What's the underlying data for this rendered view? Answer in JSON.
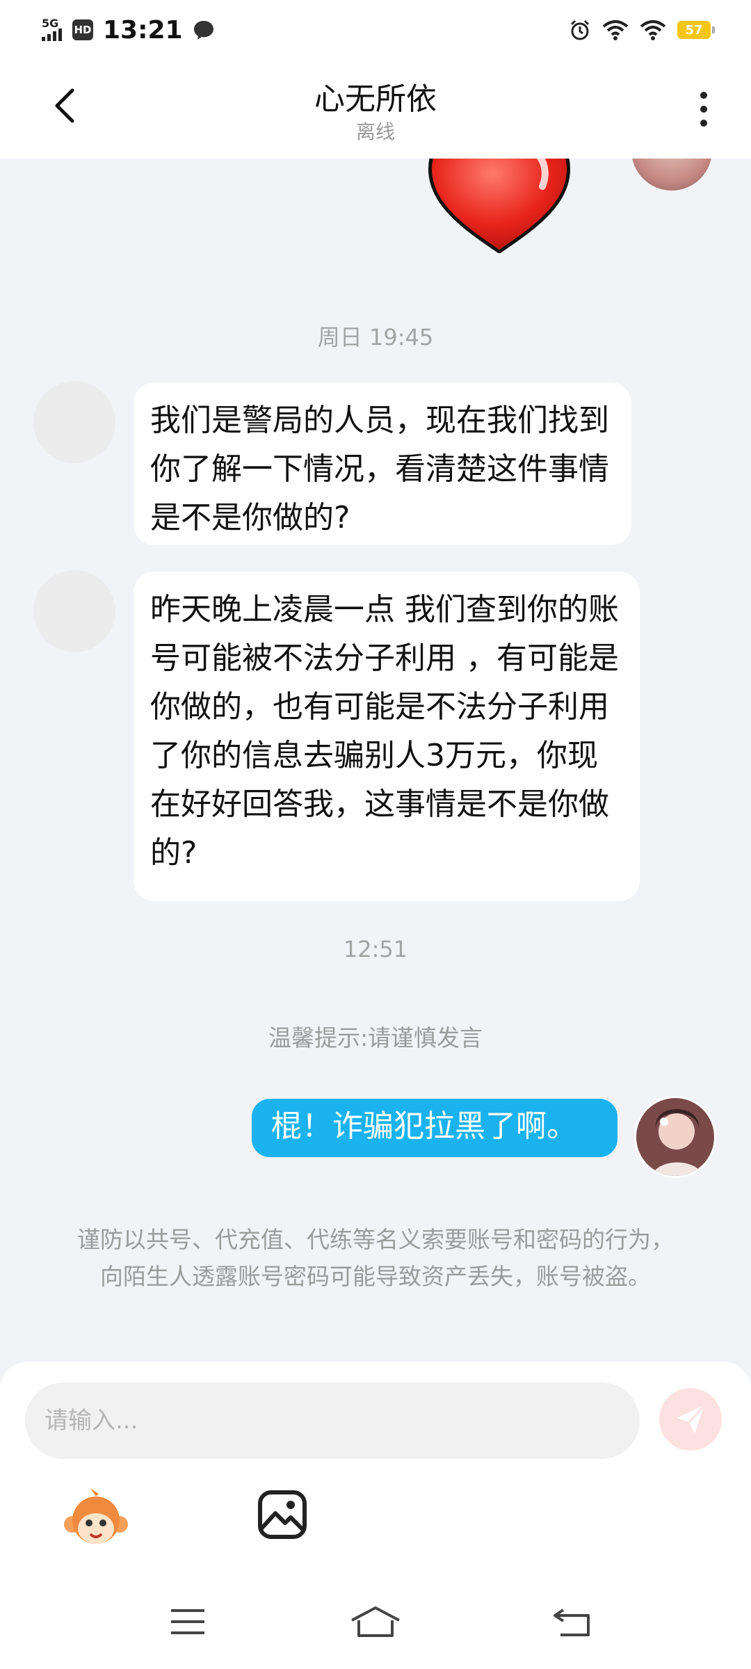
{
  "status_bar": {
    "network": "5G",
    "hd": "HD",
    "time": "13:21",
    "battery": "57"
  },
  "header": {
    "title": "心无所依",
    "subtitle": "离线"
  },
  "messages": [
    {
      "type": "timestamp",
      "text": "周日 19:45"
    },
    {
      "type": "incoming",
      "text": "我们是警局的人员，现在我们找到你了解一下情况，看清楚这件事情是不是你做的?"
    },
    {
      "type": "incoming",
      "text": "昨天晚上凌晨一点 我们查到你的账号可能被不法分子利用 ，有可能是你做的，也有可能是不法分子利用了你的信息去骗别人3万元，你现在好好回答我，这事情是不是你做的?"
    },
    {
      "type": "timestamp",
      "text": "12:51"
    },
    {
      "type": "hint",
      "text": "温馨提示:请谨慎发言"
    },
    {
      "type": "outgoing",
      "text": "棍！诈骗犯拉黑了啊。"
    }
  ],
  "warning": "谨防以共号、代充值、代练等名义索要账号和密码的行为，向陌生人透露账号密码可能导致资产丢失，账号被盗。",
  "input": {
    "placeholder": "请输入..."
  },
  "colors": {
    "accent_blue": "#1bb2f0",
    "background": "#f2f3f7",
    "send_button": "#fde0e0"
  }
}
